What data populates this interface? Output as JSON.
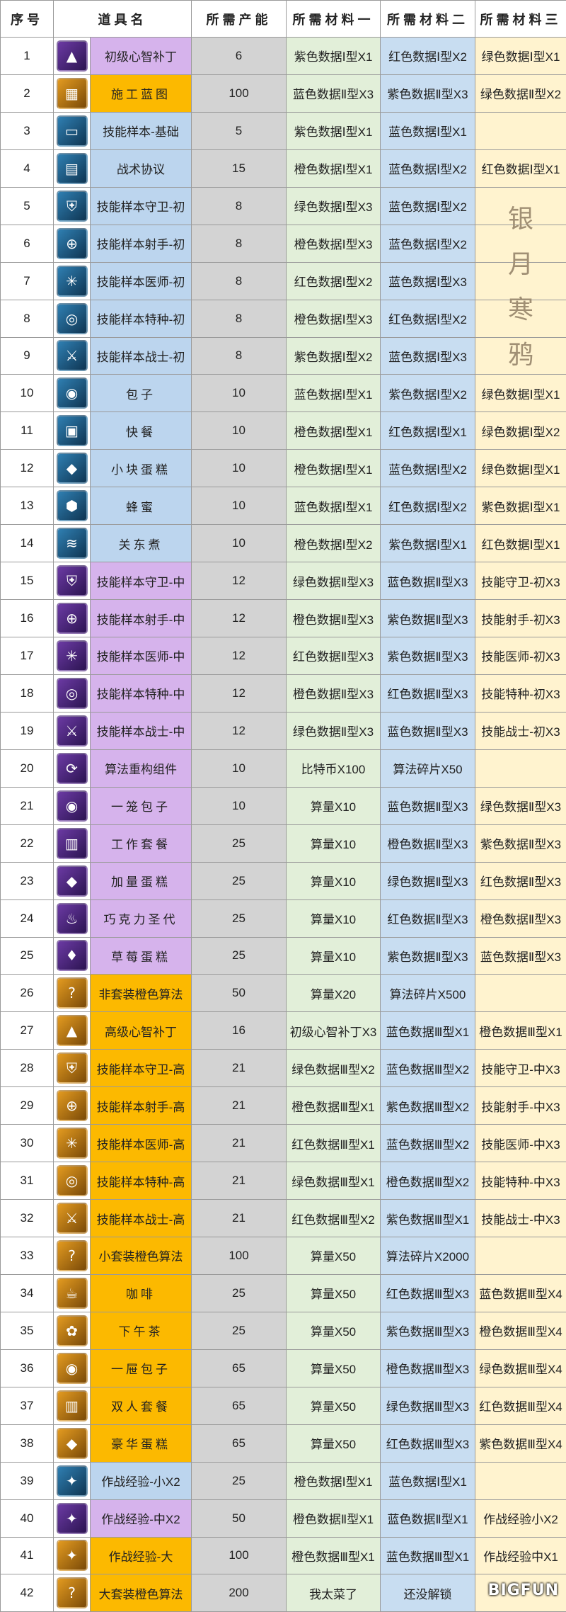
{
  "headers": [
    "序号",
    "道具名",
    "所需产能",
    "所需材料一",
    "所需材料二",
    "所需材料三"
  ],
  "watermark": [
    "银",
    "月",
    "寒",
    "鸦"
  ],
  "site_mark": "BIGFUN",
  "colors": {
    "purple": "#d6b3ec",
    "orange": "#fcb900",
    "blue": "#bcd5ee",
    "production": "#d3d3d3",
    "material1": "#e2efd9",
    "material2": "#c8ddf1",
    "material3": "#fff3cf"
  },
  "rows": [
    {
      "no": "1",
      "icon": "pyramid-icon",
      "color": "purple",
      "name": "初级心智补丁",
      "prod": "6",
      "m1": "紫色数据Ⅰ型X1",
      "m2": "红色数据Ⅰ型X2",
      "m3": "绿色数据Ⅰ型X1"
    },
    {
      "no": "2",
      "icon": "blueprint-icon",
      "color": "orange",
      "name": "施工蓝图",
      "prod": "100",
      "m1": "蓝色数据Ⅱ型X3",
      "m2": "紫色数据Ⅱ型X3",
      "m3": "绿色数据Ⅱ型X2"
    },
    {
      "no": "3",
      "icon": "card-icon",
      "color": "blue",
      "name": "技能样本-基础",
      "prod": "5",
      "m1": "紫色数据Ⅰ型X1",
      "m2": "蓝色数据Ⅰ型X1",
      "m3": ""
    },
    {
      "no": "4",
      "icon": "document-icon",
      "color": "blue",
      "name": "战术协议",
      "prod": "15",
      "m1": "橙色数据Ⅰ型X1",
      "m2": "蓝色数据Ⅰ型X2",
      "m3": "红色数据Ⅰ型X1"
    },
    {
      "no": "5",
      "icon": "shield-icon",
      "color": "blue",
      "name": "技能样本守卫-初",
      "prod": "8",
      "m1": "绿色数据Ⅰ型X3",
      "m2": "蓝色数据Ⅰ型X2",
      "m3": ""
    },
    {
      "no": "6",
      "icon": "crosshair-icon",
      "color": "blue",
      "name": "技能样本射手-初",
      "prod": "8",
      "m1": "橙色数据Ⅰ型X3",
      "m2": "蓝色数据Ⅰ型X2",
      "m3": ""
    },
    {
      "no": "7",
      "icon": "medic-icon",
      "color": "blue",
      "name": "技能样本医师-初",
      "prod": "8",
      "m1": "红色数据Ⅰ型X2",
      "m2": "蓝色数据Ⅰ型X3",
      "m3": ""
    },
    {
      "no": "8",
      "icon": "special-icon",
      "color": "blue",
      "name": "技能样本特种-初",
      "prod": "8",
      "m1": "橙色数据Ⅰ型X3",
      "m2": "红色数据Ⅰ型X2",
      "m3": ""
    },
    {
      "no": "9",
      "icon": "warrior-icon",
      "color": "blue",
      "name": "技能样本战士-初",
      "prod": "8",
      "m1": "紫色数据Ⅰ型X2",
      "m2": "蓝色数据Ⅰ型X3",
      "m3": ""
    },
    {
      "no": "10",
      "icon": "bun-icon",
      "color": "blue",
      "name": "包子",
      "prod": "10",
      "m1": "蓝色数据Ⅰ型X1",
      "m2": "紫色数据Ⅰ型X2",
      "m3": "绿色数据Ⅰ型X1"
    },
    {
      "no": "11",
      "icon": "fastfood-icon",
      "color": "blue",
      "name": "快餐",
      "prod": "10",
      "m1": "橙色数据Ⅰ型X1",
      "m2": "红色数据Ⅰ型X1",
      "m3": "绿色数据Ⅰ型X2"
    },
    {
      "no": "12",
      "icon": "cake-icon",
      "color": "blue",
      "name": "小块蛋糕",
      "prod": "10",
      "m1": "橙色数据Ⅰ型X1",
      "m2": "蓝色数据Ⅰ型X2",
      "m3": "绿色数据Ⅰ型X1"
    },
    {
      "no": "13",
      "icon": "honey-icon",
      "color": "blue",
      "name": "蜂蜜",
      "prod": "10",
      "m1": "蓝色数据Ⅰ型X1",
      "m2": "红色数据Ⅰ型X2",
      "m3": "紫色数据Ⅰ型X1"
    },
    {
      "no": "14",
      "icon": "oden-icon",
      "color": "blue",
      "name": "关东煮",
      "prod": "10",
      "m1": "橙色数据Ⅰ型X2",
      "m2": "紫色数据Ⅰ型X1",
      "m3": "红色数据Ⅰ型X1"
    },
    {
      "no": "15",
      "icon": "shield-icon",
      "color": "purple",
      "name": "技能样本守卫-中",
      "prod": "12",
      "m1": "绿色数据Ⅱ型X3",
      "m2": "蓝色数据Ⅱ型X3",
      "m3": "技能守卫-初X3"
    },
    {
      "no": "16",
      "icon": "crosshair-icon",
      "color": "purple",
      "name": "技能样本射手-中",
      "prod": "12",
      "m1": "橙色数据Ⅱ型X3",
      "m2": "紫色数据Ⅱ型X3",
      "m3": "技能射手-初X3"
    },
    {
      "no": "17",
      "icon": "medic-icon",
      "color": "purple",
      "name": "技能样本医师-中",
      "prod": "12",
      "m1": "红色数据Ⅱ型X3",
      "m2": "紫色数据Ⅱ型X3",
      "m3": "技能医师-初X3"
    },
    {
      "no": "18",
      "icon": "special-icon",
      "color": "purple",
      "name": "技能样本特种-中",
      "prod": "12",
      "m1": "橙色数据Ⅱ型X3",
      "m2": "红色数据Ⅱ型X3",
      "m3": "技能特种-初X3"
    },
    {
      "no": "19",
      "icon": "warrior-icon",
      "color": "purple",
      "name": "技能样本战士-中",
      "prod": "12",
      "m1": "绿色数据Ⅱ型X3",
      "m2": "蓝色数据Ⅱ型X3",
      "m3": "技能战士-初X3"
    },
    {
      "no": "20",
      "icon": "refresh-icon",
      "color": "purple",
      "name": "算法重构组件",
      "prod": "10",
      "m1": "比特币X100",
      "m2": "算法碎片X50",
      "m3": ""
    },
    {
      "no": "21",
      "icon": "bun-icon",
      "color": "purple",
      "name": "一笼包子",
      "prod": "10",
      "m1": "算量X10",
      "m2": "蓝色数据Ⅱ型X3",
      "m3": "绿色数据Ⅱ型X3"
    },
    {
      "no": "22",
      "icon": "meal-icon",
      "color": "purple",
      "name": "工作套餐",
      "prod": "25",
      "m1": "算量X10",
      "m2": "橙色数据Ⅱ型X3",
      "m3": "紫色数据Ⅱ型X3"
    },
    {
      "no": "23",
      "icon": "cake-icon",
      "color": "purple",
      "name": "加量蛋糕",
      "prod": "25",
      "m1": "算量X10",
      "m2": "绿色数据Ⅱ型X3",
      "m3": "红色数据Ⅱ型X3"
    },
    {
      "no": "24",
      "icon": "chocolate-icon",
      "color": "purple",
      "name": "巧克力圣代",
      "prod": "25",
      "m1": "算量X10",
      "m2": "红色数据Ⅱ型X3",
      "m3": "橙色数据Ⅱ型X3"
    },
    {
      "no": "25",
      "icon": "strawberry-cake-icon",
      "color": "purple",
      "name": "草莓蛋糕",
      "prod": "25",
      "m1": "算量X10",
      "m2": "紫色数据Ⅱ型X3",
      "m3": "蓝色数据Ⅱ型X3"
    },
    {
      "no": "26",
      "icon": "question-icon",
      "color": "orange",
      "name": "非套装橙色算法",
      "prod": "50",
      "m1": "算量X20",
      "m2": "算法碎片X500",
      "m3": ""
    },
    {
      "no": "27",
      "icon": "pyramid-icon",
      "color": "orange",
      "name": "高级心智补丁",
      "prod": "16",
      "m1": "初级心智补丁X3",
      "m2": "蓝色数据Ⅲ型X1",
      "m3": "橙色数据Ⅲ型X1"
    },
    {
      "no": "28",
      "icon": "shield-icon",
      "color": "orange",
      "name": "技能样本守卫-高",
      "prod": "21",
      "m1": "绿色数据Ⅲ型X2",
      "m2": "蓝色数据Ⅲ型X2",
      "m3": "技能守卫-中X3"
    },
    {
      "no": "29",
      "icon": "crosshair-icon",
      "color": "orange",
      "name": "技能样本射手-高",
      "prod": "21",
      "m1": "橙色数据Ⅲ型X1",
      "m2": "紫色数据Ⅲ型X2",
      "m3": "技能射手-中X3"
    },
    {
      "no": "30",
      "icon": "medic-icon",
      "color": "orange",
      "name": "技能样本医师-高",
      "prod": "21",
      "m1": "红色数据Ⅲ型X1",
      "m2": "蓝色数据Ⅲ型X2",
      "m3": "技能医师-中X3"
    },
    {
      "no": "31",
      "icon": "special-icon",
      "color": "orange",
      "name": "技能样本特种-高",
      "prod": "21",
      "m1": "绿色数据Ⅲ型X1",
      "m2": "橙色数据Ⅲ型X2",
      "m3": "技能特种-中X3"
    },
    {
      "no": "32",
      "icon": "warrior-icon",
      "color": "orange",
      "name": "技能样本战士-高",
      "prod": "21",
      "m1": "红色数据Ⅲ型X2",
      "m2": "紫色数据Ⅲ型X1",
      "m3": "技能战士-中X3"
    },
    {
      "no": "33",
      "icon": "question-icon",
      "color": "orange",
      "name": "小套装橙色算法",
      "prod": "100",
      "m1": "算量X50",
      "m2": "算法碎片X2000",
      "m3": ""
    },
    {
      "no": "34",
      "icon": "coffee-icon",
      "color": "orange",
      "name": "咖啡",
      "prod": "25",
      "m1": "算量X50",
      "m2": "红色数据Ⅲ型X3",
      "m3": "蓝色数据Ⅲ型X4"
    },
    {
      "no": "35",
      "icon": "teatime-icon",
      "color": "orange",
      "name": "下午茶",
      "prod": "25",
      "m1": "算量X50",
      "m2": "紫色数据Ⅲ型X3",
      "m3": "橙色数据Ⅲ型X4"
    },
    {
      "no": "36",
      "icon": "bun-icon",
      "color": "orange",
      "name": "一屉包子",
      "prod": "65",
      "m1": "算量X50",
      "m2": "橙色数据Ⅲ型X3",
      "m3": "绿色数据Ⅲ型X4"
    },
    {
      "no": "37",
      "icon": "meal-icon",
      "color": "orange",
      "name": "双人套餐",
      "prod": "65",
      "m1": "算量X50",
      "m2": "绿色数据Ⅲ型X3",
      "m3": "红色数据Ⅲ型X4"
    },
    {
      "no": "38",
      "icon": "cake-icon",
      "color": "orange",
      "name": "豪华蛋糕",
      "prod": "65",
      "m1": "算量X50",
      "m2": "红色数据Ⅲ型X3",
      "m3": "紫色数据Ⅲ型X4"
    },
    {
      "no": "39",
      "icon": "exp-icon",
      "color": "blue",
      "name": "作战经验-小X2",
      "prod": "25",
      "m1": "橙色数据Ⅰ型X1",
      "m2": "蓝色数据Ⅰ型X1",
      "m3": ""
    },
    {
      "no": "40",
      "icon": "exp-icon",
      "color": "purple",
      "name": "作战经验-中X2",
      "prod": "50",
      "m1": "橙色数据Ⅱ型X1",
      "m2": "蓝色数据Ⅱ型X1",
      "m3": "作战经验小X2"
    },
    {
      "no": "41",
      "icon": "exp-icon",
      "color": "orange",
      "name": "作战经验-大",
      "prod": "100",
      "m1": "橙色数据Ⅲ型X1",
      "m2": "蓝色数据Ⅲ型X1",
      "m3": "作战经验中X1"
    },
    {
      "no": "42",
      "icon": "question-icon",
      "color": "orange",
      "name": "大套装橙色算法",
      "prod": "200",
      "m1": "我太菜了",
      "m2": "还没解锁",
      "m3": ""
    }
  ]
}
